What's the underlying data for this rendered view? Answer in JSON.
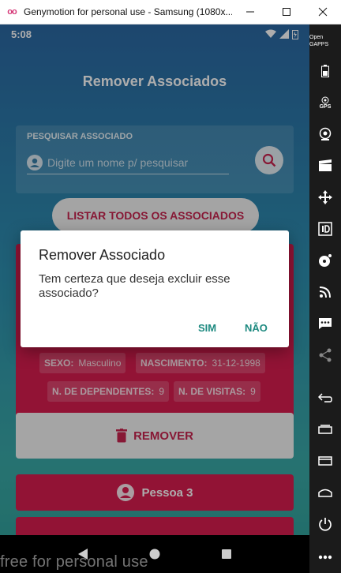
{
  "window": {
    "title": "Genymotion for personal use - Samsung (1080x...",
    "controls": [
      "minimize",
      "maximize",
      "close"
    ]
  },
  "status_bar": {
    "time": "5:08"
  },
  "app": {
    "title": "Remover Associados",
    "search": {
      "label": "PESQUISAR ASSOCIADO",
      "placeholder": "Digite um nome p/ pesquisar"
    },
    "list_button": "LISTAR TODOS OS ASSOCIADOS",
    "card": {
      "fields": [
        {
          "label": "SEXO:",
          "value": "Masculino"
        },
        {
          "label": "NASCIMENTO:",
          "value": "31-12-1998"
        },
        {
          "label": "N. DE DEPENDENTES:",
          "value": "9"
        },
        {
          "label": "N. DE VISITAS:",
          "value": "9"
        }
      ]
    },
    "remove_button": "REMOVER",
    "next_card": {
      "title": "Pessoa 3"
    }
  },
  "dialog": {
    "title": "Remover Associado",
    "message": "Tem certeza que deseja excluir esse associado?",
    "confirm": "SIM",
    "cancel": "NÃO"
  },
  "watermark": "free for personal use",
  "toolbar": {
    "items": [
      "open-gapps-icon",
      "battery-icon",
      "gps-icon",
      "camera-icon",
      "clapperboard-icon",
      "move-icon",
      "id-icon",
      "disk-icon",
      "rss-icon",
      "message-icon",
      "share-icon",
      "back-icon",
      "recent-apps-icon",
      "menu-icon",
      "home-icon",
      "power-icon",
      "more-icon"
    ],
    "gapps_label": "Open GAPPS",
    "gps_label": "GPS"
  },
  "colors": {
    "accent": "#d81c4e",
    "dialog_button": "#1e8a80"
  }
}
